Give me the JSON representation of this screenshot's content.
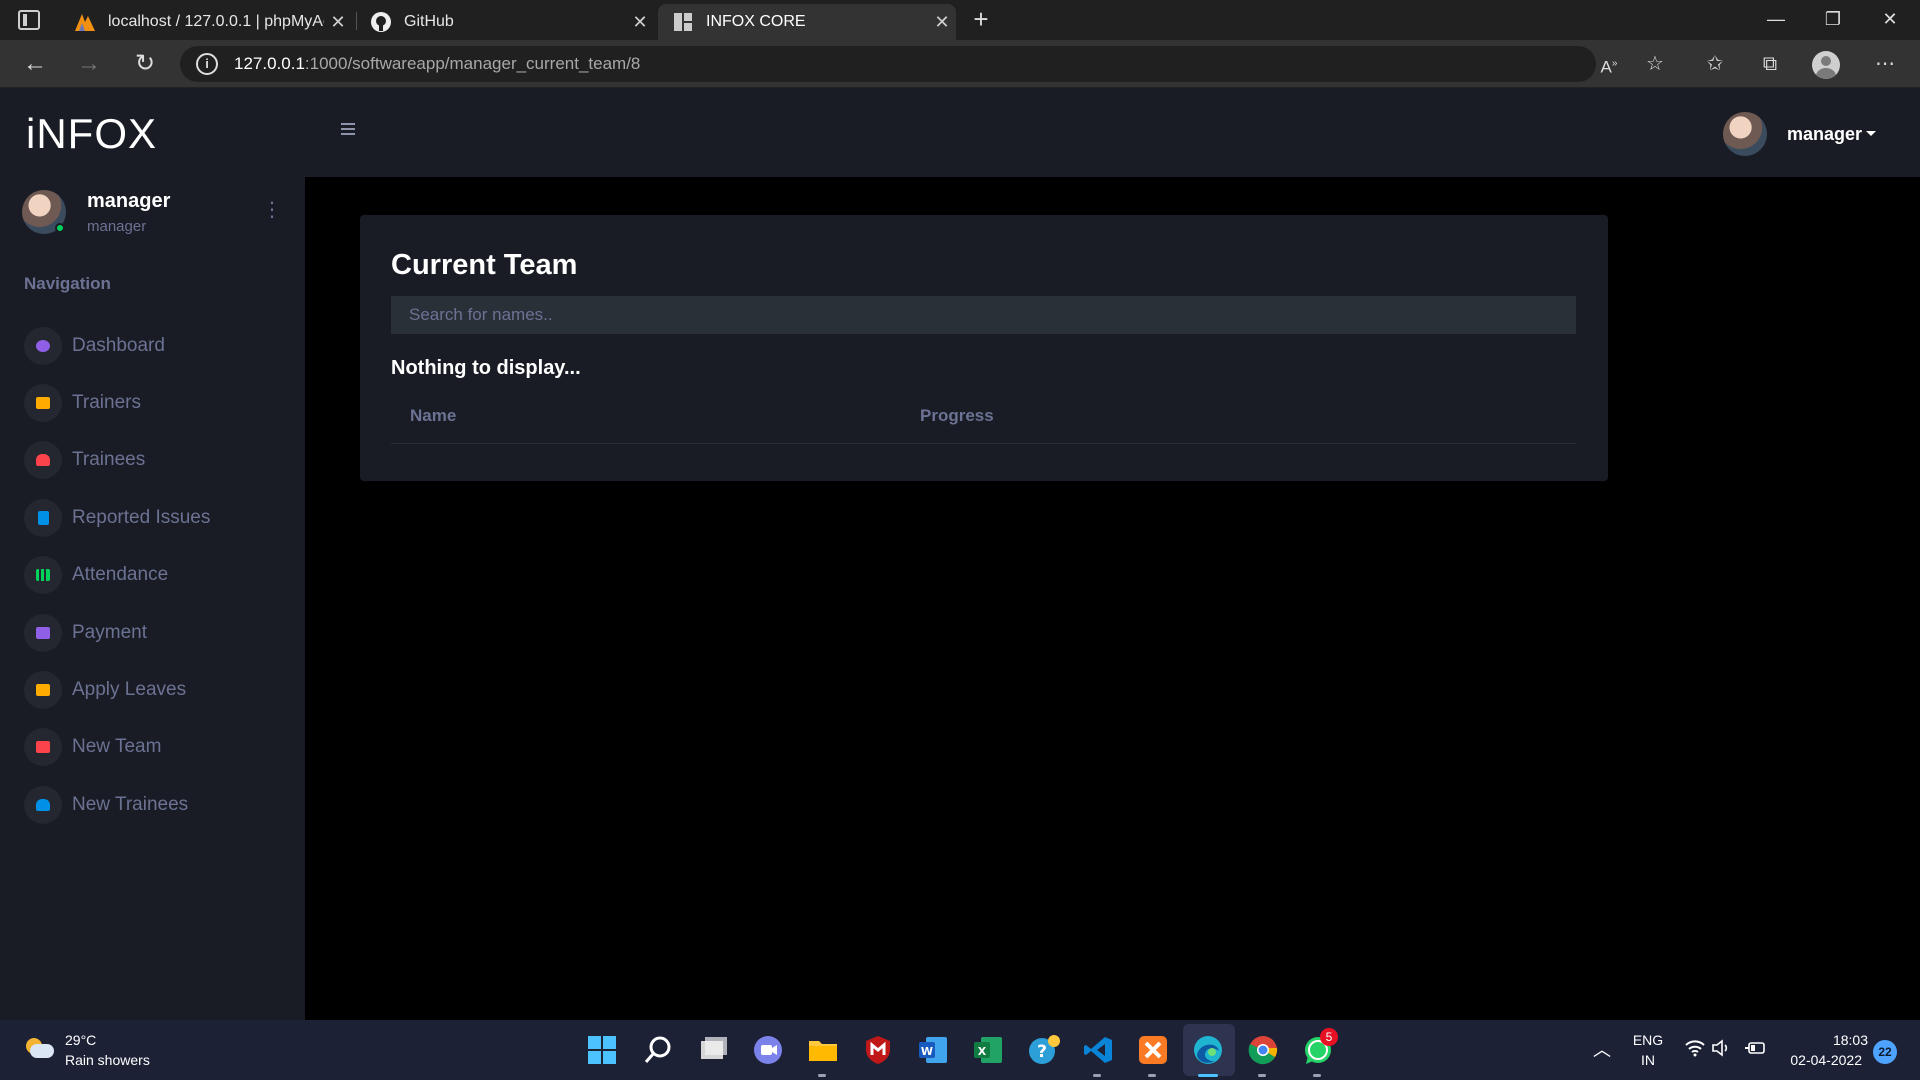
{
  "browser": {
    "tabs": [
      {
        "title": "localhost / 127.0.0.1 | phpMyAdmin"
      },
      {
        "title": "GitHub"
      },
      {
        "title": "INFOX CORE"
      }
    ],
    "url_host": "127.0.0.1",
    "url_path": ":1000/softwareapp/manager_current_team/8"
  },
  "app": {
    "logo": "iNFOX",
    "user": {
      "name": "manager",
      "role": "manager"
    },
    "nav_title": "Navigation",
    "nav": [
      {
        "label": "Dashboard",
        "icon": "speedometer-icon",
        "color": "#8f5fe8"
      },
      {
        "label": "Trainers",
        "icon": "laptop-icon",
        "color": "#ffab00"
      },
      {
        "label": "Trainees",
        "icon": "people-icon",
        "color": "#fc424a"
      },
      {
        "label": "Reported Issues",
        "icon": "document-icon",
        "color": "#0090e7"
      },
      {
        "label": "Attendance",
        "icon": "bar-chart-icon",
        "color": "#00d25b"
      },
      {
        "label": "Payment",
        "icon": "payment-icon",
        "color": "#8f5fe8"
      },
      {
        "label": "Apply Leaves",
        "icon": "message-icon",
        "color": "#ffab00"
      },
      {
        "label": "New Team",
        "icon": "folder-icon",
        "color": "#fc424a"
      },
      {
        "label": "New Trainees",
        "icon": "group-add-icon",
        "color": "#0090e7"
      }
    ],
    "topbar_user": "manager"
  },
  "card": {
    "title": "Current Team",
    "search_placeholder": "Search for names..",
    "empty_message": "Nothing to display...",
    "columns": [
      "Name",
      "Progress"
    ]
  },
  "taskbar": {
    "temperature": "29°C",
    "weather": "Rain showers",
    "whatsapp_badge": "5",
    "language": "ENG",
    "region": "IN",
    "time": "18:03",
    "date": "02-04-2022",
    "notifications": "22"
  }
}
